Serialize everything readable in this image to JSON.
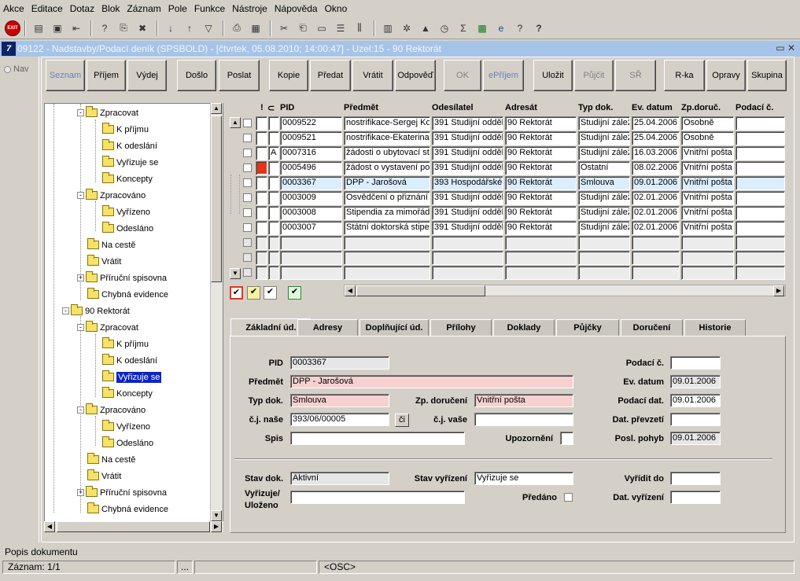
{
  "menu": [
    "Akce",
    "Editace",
    "Dotaz",
    "Blok",
    "Záznam",
    "Pole",
    "Funkce",
    "Nástroje",
    "Nápověda",
    "Okno"
  ],
  "exit_label": "EXIT",
  "window_title": "09122 - Nadstavby/Podací deník (SPSBOLD) - [čtvrtek, 05.08.2010; 14:00:47] - Uzel:15 - 90 Rektorát",
  "window_logo": "7",
  "nav_label": "Nav",
  "buttons": [
    "Seznam",
    "Příjem",
    "Výdej",
    "Došlo",
    "Poslat",
    "Kopie",
    "Předat",
    "Vrátit",
    "Odpověď",
    "OK",
    "ePříjem",
    "Uložit",
    "Půjčit",
    "SŘ",
    "R-ka",
    "Opravy",
    "Skupina"
  ],
  "tree": [
    {
      "label": "Zpracovat",
      "pm": "-"
    },
    {
      "label": "K příjmu"
    },
    {
      "label": "K odeslání"
    },
    {
      "label": "Vyřizuje se"
    },
    {
      "label": "Koncepty"
    },
    {
      "label": "Zpracováno",
      "pm": "-"
    },
    {
      "label": "Vyřízeno"
    },
    {
      "label": "Odesláno"
    },
    {
      "label": "Na cestě"
    },
    {
      "label": "Vrátit"
    },
    {
      "label": "Příruční spisovna",
      "pm": "+"
    },
    {
      "label": "Chybná evidence"
    },
    {
      "label": "90 Rektorát",
      "pm": "-"
    },
    {
      "label": "Zpracovat",
      "pm": "-"
    },
    {
      "label": "K příjmu"
    },
    {
      "label": "K odeslání"
    },
    {
      "label": "Vyřizuje se",
      "selected": true
    },
    {
      "label": "Koncepty"
    },
    {
      "label": "Zpracováno",
      "pm": "-"
    },
    {
      "label": "Vyřízeno"
    },
    {
      "label": "Odesláno"
    },
    {
      "label": "Na cestě"
    },
    {
      "label": "Vrátit"
    },
    {
      "label": "Příruční spisovna",
      "pm": "+"
    },
    {
      "label": "Chybná evidence"
    }
  ],
  "grid": {
    "headers": [
      "!",
      "PID",
      "Předmět",
      "Odesílatel",
      "Adresát",
      "Typ dok.",
      "Ev. datum",
      "Zp.doruč.",
      "Podací č."
    ],
    "rows": [
      [
        "",
        "0009522",
        "nostrifikace-Sergej Ko",
        "391 Studijní odděle",
        "90 Rektorát",
        "Studijní zálež",
        "25.04.2006",
        "Osobně",
        ""
      ],
      [
        "",
        "0009521",
        "nostrifikace-Ekaterina",
        "391 Studijní odděle",
        "90 Rektorát",
        "Studijní zálež",
        "25.04.2006",
        "Osobně",
        ""
      ],
      [
        "A",
        "0007316",
        "žádosti o ubytovací st",
        "391 Studijní odděle",
        "90 Rektorát",
        "Studijní zálež",
        "16.03.2006",
        "Vnitřní pošta",
        ""
      ],
      [
        "",
        "0005496",
        "žádost o vystavení po",
        "391 Studijní odděle",
        "90 Rektorát",
        "Ostatní",
        "08.02.2006",
        "Vnitřní pošta",
        ""
      ],
      [
        "",
        "0003367",
        "DPP - Jarošová",
        "393 Hospodářské",
        "90 Rektorát",
        "Smlouva",
        "09.01.2006",
        "Vnitřní pošta",
        ""
      ],
      [
        "",
        "0003009",
        "Osvědčení o přiznání",
        "391 Studijní odděle",
        "90 Rektorát",
        "Studijní zálež",
        "02.01.2006",
        "Vnitřní pošta",
        ""
      ],
      [
        "",
        "0003008",
        "Stipendia za mimořádn",
        "391 Studijní odděle",
        "90 Rektorát",
        "Studijní zálež",
        "02.01.2006",
        "Vnitřní pošta",
        ""
      ],
      [
        "",
        "0003007",
        "Státní doktorská stiper",
        "391 Studijní odděle",
        "90 Rektorát",
        "Studijní zálež",
        "02.01.2006",
        "Vnitřní pošta",
        ""
      ]
    ]
  },
  "legend_marks": [
    "✔",
    "✔",
    "✔",
    "✔"
  ],
  "tabs": [
    "Základní úd.",
    "Adresy",
    "Doplňující úd.",
    "Přílohy",
    "Doklady",
    "Půjčky",
    "Doručení",
    "Historie"
  ],
  "form": {
    "pid_label": "PID",
    "pid": "0003367",
    "predmet_label": "Předmět",
    "predmet": "DPP - Jarošová",
    "typdok_label": "Typ dok.",
    "typdok": "Smlouva",
    "zpdor_label": "Zp. doručení",
    "zpdor": "Vnitřní pošta",
    "cjnase_label": "č.j. naše",
    "cjnase": "393/06/00005",
    "ci_btn": "či",
    "cjvase_label": "č.j. vaše",
    "cjvase": "",
    "spis_label": "Spis",
    "spis": "",
    "upoz_label": "Upozornění",
    "podacic_label": "Podací č.",
    "podacic": "",
    "evdatum_label": "Ev. datum",
    "evdatum": "09.01.2006",
    "podacidat_label": "Podací dat.",
    "podacidat": "09.01.2006",
    "datprevz_label": "Dat. převzetí",
    "datprevz": "",
    "poslpohyb_label": "Posl. pohyb",
    "poslpohyb": "09.01.2006",
    "stavdok_label": "Stav dok.",
    "stavdok": "Aktivní",
    "stavvyr_label": "Stav vyřízení",
    "stavvyr": "Vyřizuje se",
    "vyriditdo_label": "Vyřídit do",
    "vyriditdo": "",
    "vyrizuje_label1": "Vyřizuje/",
    "vyrizuje_label2": "Uloženo",
    "vyrizuje": "",
    "predano_label": "Předáno",
    "datvyr_label": "Dat. vyřízení",
    "datvyr": ""
  },
  "status": {
    "desc": "Popis dokumentu",
    "record": "Záznam: 1/1",
    "dots": "...",
    "osc": "<OSC>"
  }
}
